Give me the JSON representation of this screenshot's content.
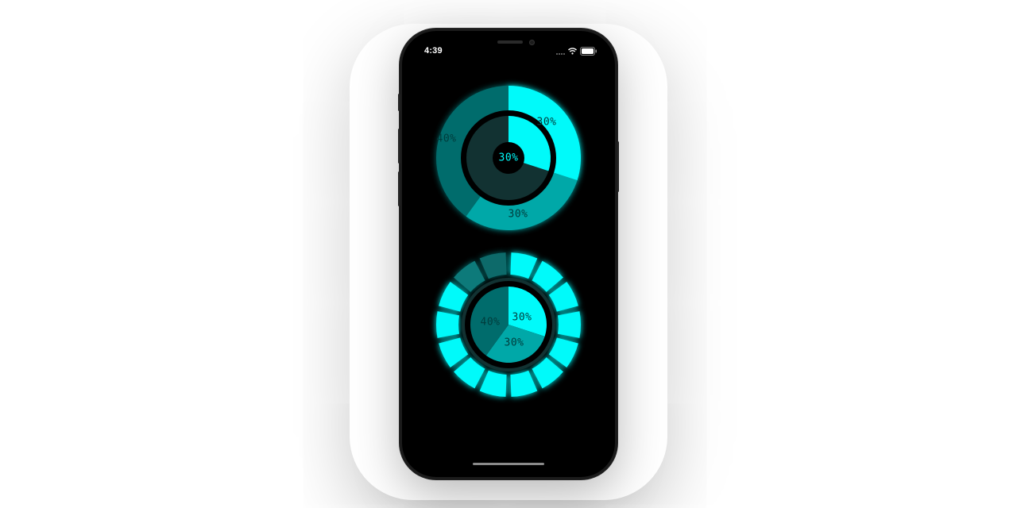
{
  "status_bar": {
    "time": "4:39"
  },
  "colors": {
    "bright": "#00fafa",
    "medium": "#00a8a8",
    "dark": "#006c6c",
    "ring_bg": "#123232"
  },
  "chart_data": [
    {
      "type": "pie",
      "style": "concentric rings",
      "series": [
        {
          "values": [
            30,
            30,
            40
          ],
          "labels": [
            "30%",
            "30%",
            "40%"
          ]
        },
        {
          "values": [
            30
          ],
          "labels": [
            "30%"
          ]
        }
      ]
    },
    {
      "type": "pie",
      "style": "segmented ring with inner pie",
      "series": [
        {
          "values": [
            30,
            30,
            40
          ],
          "labels": [
            "30%",
            "30%",
            "40%"
          ]
        }
      ],
      "segments": 14
    }
  ]
}
